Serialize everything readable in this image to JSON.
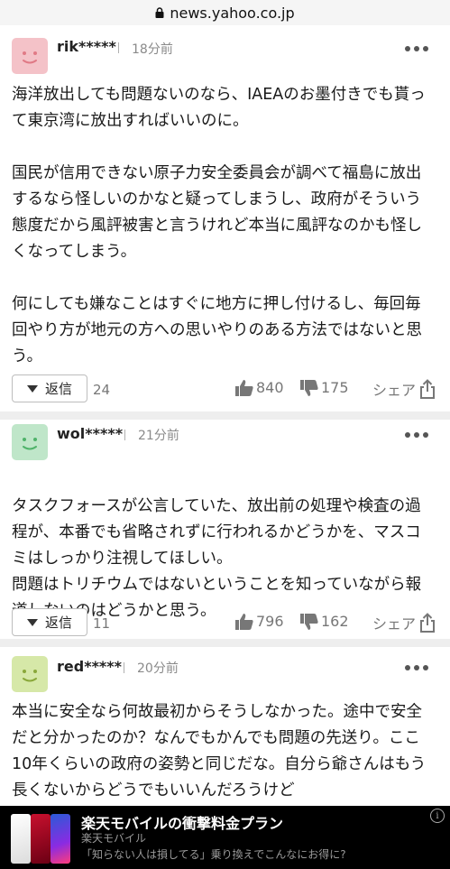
{
  "browser": {
    "url": "news.yahoo.co.jp"
  },
  "comments": [
    {
      "username": "rik*****",
      "time": "18分前",
      "avatar_color": "#f4c2c8",
      "paragraphs": [
        "海洋放出しても問題ないのなら、IAEAのお墨付きでも貰って東京湾に放出すればいいのに。",
        "国民が信用できない原子力安全委員会が調べて福島に放出するなら怪しいのかなと疑ってしまうし、政府がそういう態度だから風評被害と言うけれど本当に風評なのかも怪しくなってしまう。",
        "何にしても嫌なことはすぐに地方に押し付けるし、毎回毎回やり方が地元の方への思いやりのある方法ではないと思う。"
      ],
      "reply_label": "返信",
      "reply_count": "24",
      "likes": "840",
      "dislikes": "175",
      "share_label": "シェア"
    },
    {
      "username": "wol*****",
      "time": "21分前",
      "avatar_color": "#bfe6c9",
      "paragraphs": [
        "タスクフォースが公言していた、放出前の処理や検査の過程が、本番でも省略されずに行われるかどうかを、マスコミはしっかり注視してほしい。\n問題はトリチウムではないということを知っていながら報道しないのはどうかと思う。"
      ],
      "reply_label": "返信",
      "reply_count": "11",
      "likes": "796",
      "dislikes": "162",
      "share_label": "シェア"
    },
    {
      "username": "red*****",
      "time": "20分前",
      "avatar_color": "#d6e8a8",
      "paragraphs": [
        "本当に安全なら何故最初からそうしなかった。途中で安全だと分かったのか？なんでもかんでも問題の先送り。ここ10年くらいの政府の姿勢と同じだな。自分ら爺さんはもう長くないからどうでもいいんだろうけど"
      ]
    }
  ],
  "ad": {
    "title": "楽天モバイルの衝撃料金プラン",
    "brand": "楽天モバイル",
    "description": "「知らない人は損してる」乗り換えでこんなにお得に?"
  },
  "colors": {
    "vote_gray": "#777777",
    "ad_bg": "#000000"
  }
}
